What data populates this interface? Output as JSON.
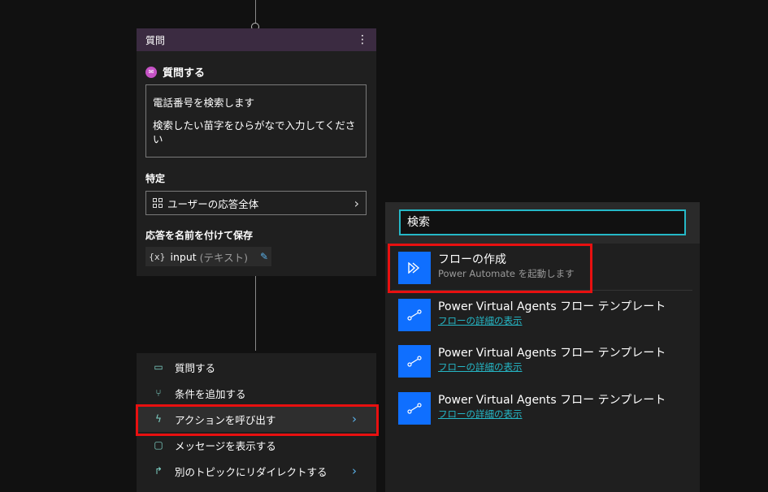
{
  "question_card": {
    "header_title": "質問",
    "more_icon": "more-vertical-icon",
    "ask_label": "質問する",
    "message_lines": [
      "電話番号を検索します",
      "検索したい苗字をひらがなで入力してください"
    ],
    "identify_label": "特定",
    "identify_value": "ユーザーの応答全体",
    "save_label": "応答を名前を付けて保存",
    "variable_prefix": "{x}",
    "variable_name": "input",
    "variable_type": "(テキスト)"
  },
  "action_menu": {
    "items": [
      {
        "label": "質問する",
        "icon": "chat-icon"
      },
      {
        "label": "条件を追加する",
        "icon": "branch-icon"
      },
      {
        "label": "アクションを呼び出す",
        "icon": "lightning-icon"
      },
      {
        "label": "メッセージを表示する",
        "icon": "message-icon"
      },
      {
        "label": "別のトピックにリダイレクトする",
        "icon": "redirect-icon"
      }
    ]
  },
  "flow_panel": {
    "search_value": "検索",
    "create_flow": {
      "title": "フローの作成",
      "subtitle": "Power Automate を起動します"
    },
    "templates": [
      {
        "title": "Power Virtual Agents フロー テンプレート",
        "link": "フローの詳細の表示"
      },
      {
        "title": "Power Virtual Agents フロー テンプレート",
        "link": "フローの詳細の表示"
      },
      {
        "title": "Power Virtual Agents フロー テンプレート",
        "link": "フローの詳細の表示"
      }
    ]
  },
  "colors": {
    "accent_teal": "#25b8c7",
    "flow_blue": "#0f6fff",
    "highlight_red": "#e81010",
    "card_header": "#3b2b41"
  }
}
